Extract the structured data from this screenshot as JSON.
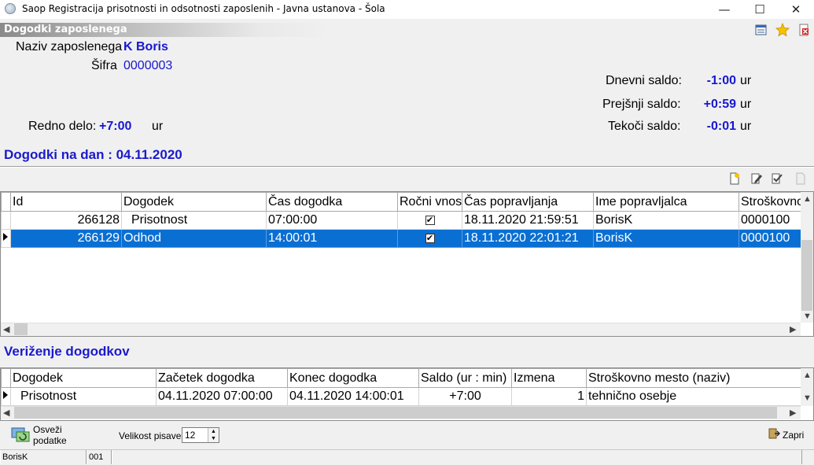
{
  "window": {
    "title": "Saop Registracija prisotnosti in odsotnosti zaposlenih - Javna ustanova - Šola",
    "min": "—",
    "max": "☐",
    "close": "✕"
  },
  "header": {
    "caption": "Dogodki zaposlenega",
    "employee_name_label": "Naziv zaposlenega",
    "employee_name": "K Boris",
    "code_label": "Šifra",
    "code": "0000003",
    "regular_work_label": "Redno delo:",
    "regular_work_value": "+7:00",
    "regular_work_unit": "ur",
    "daily_balance_label": "Dnevni saldo:",
    "daily_balance_value": "-1:00",
    "previous_balance_label": "Prejšnji saldo:",
    "previous_balance_value": "+0:59",
    "current_balance_label": "Tekoči saldo:",
    "current_balance_value": "-0:01",
    "unit": "ur"
  },
  "events": {
    "title": "Dogodki na dan : 04.11.2020",
    "columns": [
      "Id",
      "Dogodek",
      "Čas dogodka",
      "Ročni vnos",
      "Čas popravljanja",
      "Ime popravljalca",
      "Stroškovno"
    ],
    "rows": [
      {
        "id": "266128",
        "event": "Prisotnost",
        "time": "07:00:00",
        "manual": "✔",
        "edited_time": "18.11.2020 21:59:51",
        "editor": "BorisK",
        "cost": "0000100"
      },
      {
        "id": "266129",
        "event": "Odhod",
        "time": "14:00:01",
        "manual": "✔",
        "edited_time": "18.11.2020 22:01:21",
        "editor": "BorisK",
        "cost": "0000100"
      }
    ],
    "selected_row": 1
  },
  "chaining": {
    "title": "Veriženje dogodkov",
    "columns": [
      "Dogodek",
      "Začetek dogodka",
      "Konec dogodka",
      "Saldo (ur : min)",
      "Izmena",
      "Stroškovno mesto (naziv)"
    ],
    "rows": [
      {
        "event": "Prisotnost",
        "start": "04.11.2020 07:00:00",
        "end": "04.11.2020 14:00:01",
        "balance": "+7:00",
        "shift": "1",
        "cost_center": "tehnično osebje"
      }
    ]
  },
  "footer": {
    "refresh_label": "Osveži podatke",
    "font_size_label": "Velikost pisave:",
    "font_size_value": "12",
    "close_label": "Zapri"
  },
  "status": {
    "user": "BorisK",
    "code": "001"
  }
}
